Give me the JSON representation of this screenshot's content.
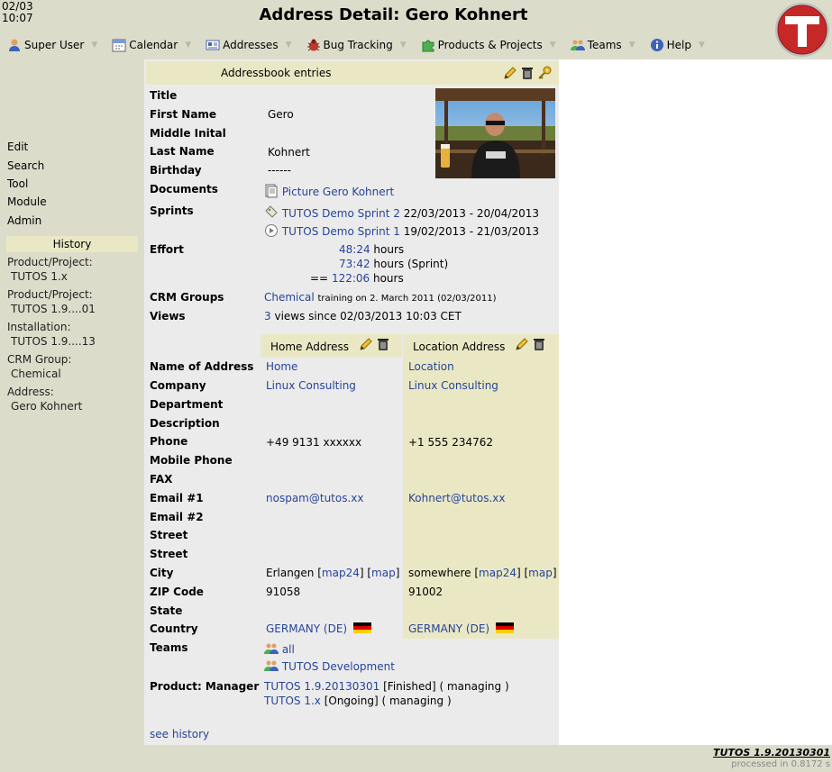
{
  "header": {
    "date": "02/03",
    "time": "10:07",
    "title": "Address Detail: Gero Kohnert"
  },
  "menu": [
    {
      "label": "Super User",
      "icon": "user-icon"
    },
    {
      "label": "Calendar",
      "icon": "calendar-icon"
    },
    {
      "label": "Addresses",
      "icon": "address-card-icon"
    },
    {
      "label": "Bug Tracking",
      "icon": "bug-icon"
    },
    {
      "label": "Products & Projects",
      "icon": "puzzle-icon"
    },
    {
      "label": "Teams",
      "icon": "team-icon"
    },
    {
      "label": "Help",
      "icon": "info-icon"
    }
  ],
  "sidebar": {
    "links": [
      "Edit",
      "Search",
      "Tool",
      "Module",
      "Admin"
    ],
    "history_title": "History",
    "history": [
      {
        "label": "Product/Project:",
        "value": "TUTOS 1.x"
      },
      {
        "label": "Product/Project:",
        "value": "TUTOS 1.9....01"
      },
      {
        "label": "Installation:",
        "value": "TUTOS 1.9....13"
      },
      {
        "label": "CRM Group:",
        "value": "Chemical"
      },
      {
        "label": "Address:",
        "value": "Gero Kohnert"
      }
    ]
  },
  "entries": {
    "title": "Addressbook entries",
    "fields": {
      "title": {
        "label": "Title",
        "value": ""
      },
      "first_name": {
        "label": "First Name",
        "value": "Gero"
      },
      "middle_initial": {
        "label": "Middle Inital",
        "value": ""
      },
      "last_name": {
        "label": "Last Name",
        "value": "Kohnert"
      },
      "birthday": {
        "label": "Birthday",
        "value": "------"
      }
    },
    "documents": {
      "label": "Documents",
      "link": "Picture Gero Kohnert"
    },
    "sprints": {
      "label": "Sprints",
      "items": [
        {
          "link": "TUTOS Demo Sprint 2",
          "dates": "22/03/2013 - 20/04/2013"
        },
        {
          "link": "TUTOS Demo Sprint 1",
          "dates": "19/02/2013 - 21/03/2013"
        }
      ]
    },
    "effort": {
      "label": "Effort",
      "rows": [
        {
          "value": "48:24",
          "suffix": "hours"
        },
        {
          "value": "73:42",
          "suffix": "hours (Sprint)"
        },
        {
          "prefix": "==",
          "value": "122:06",
          "suffix": "hours"
        }
      ]
    },
    "crm": {
      "label": "CRM Groups",
      "link": "Chemical",
      "note": "training on 2. March 2011 (02/03/2011)"
    },
    "views": {
      "label": "Views",
      "count": "3",
      "text": "views since 02/03/2013 10:03 CET"
    }
  },
  "address": {
    "home_title": "Home Address",
    "location_title": "Location Address",
    "rows": [
      {
        "label": "Name of Address",
        "home": "Home",
        "loc": "Location"
      },
      {
        "label": "Company",
        "home": "Linux Consulting",
        "loc": "Linux Consulting"
      },
      {
        "label": "Department",
        "home": "",
        "loc": ""
      },
      {
        "label": "Description",
        "home": "",
        "loc": ""
      },
      {
        "label": "Phone",
        "home": "+49 9131 xxxxxx",
        "loc": "+1 555 234762"
      },
      {
        "label": "Mobile Phone",
        "home": "",
        "loc": ""
      },
      {
        "label": "FAX",
        "home": "",
        "loc": ""
      },
      {
        "label": "Email #1",
        "home": "nospam@tutos.xx",
        "loc": "Kohnert@tutos.xx"
      },
      {
        "label": "Email #2",
        "home": "",
        "loc": ""
      },
      {
        "label": "Street",
        "home": "",
        "loc": ""
      },
      {
        "label": "Street",
        "home": "",
        "loc": ""
      },
      {
        "label": "City",
        "home": "Erlangen",
        "loc": "somewhere"
      },
      {
        "label": "ZIP Code",
        "home": "91058",
        "loc": "91002"
      },
      {
        "label": "State",
        "home": "",
        "loc": ""
      },
      {
        "label": "Country",
        "home": "GERMANY (DE)",
        "loc": "GERMANY (DE)"
      }
    ],
    "map24": "map24",
    "map": "map"
  },
  "teams": {
    "label": "Teams",
    "items": [
      "all",
      "TUTOS Development"
    ]
  },
  "product": {
    "label": "Product: Manager",
    "items": [
      {
        "link": "TUTOS 1.9.20130301",
        "status": "[Finished]",
        "role": "( managing )"
      },
      {
        "link": "TUTOS 1.x",
        "status": "[Ongoing]",
        "role": "( managing )"
      }
    ]
  },
  "see_history": "see history",
  "footer": {
    "brand": "TUTOS 1.9.20130301",
    "processed": "processed in 0.8172 s"
  },
  "colors": {
    "background": "#dcdccb",
    "panel": "#ecebeb",
    "header_band": "#eae8c4",
    "link": "#25449a",
    "logo_red": "#c62828"
  }
}
